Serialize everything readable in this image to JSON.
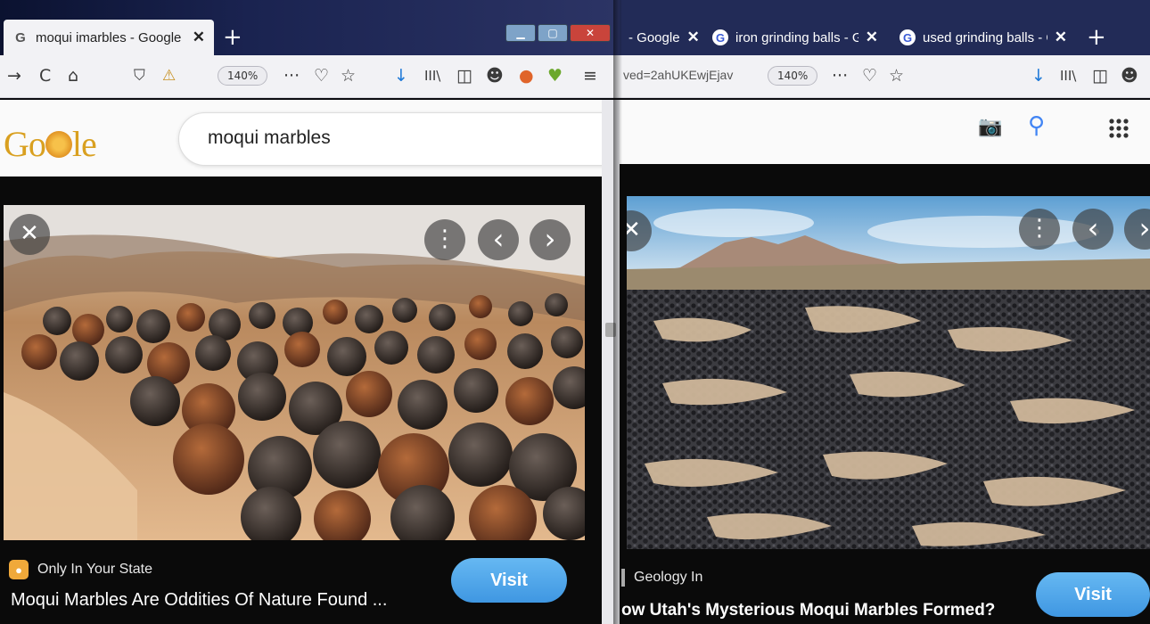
{
  "left_window": {
    "tab": {
      "favicon": "G",
      "title": "moqui imarbles - Google Searc",
      "close": "✕"
    },
    "new_tab": "+",
    "window_controls": {
      "minimize": "▁",
      "maximize": "▢",
      "close": "✕"
    },
    "toolbar": {
      "back": "→",
      "reload": "C",
      "home": "⌂",
      "shield": "⛉",
      "warning": "⚠",
      "zoom": "140%",
      "more": "···",
      "pocket": "♡",
      "bookmark": "☆",
      "download": "↓",
      "library": "III\\",
      "sidebar": "◫",
      "account": "☻",
      "ext1": "●",
      "ext2": "♥",
      "menu": "≡"
    },
    "google": {
      "logo_left": "Go",
      "logo_right": "le",
      "search_query": "moqui marbles"
    },
    "viewer": {
      "close_icon": "✕",
      "more_icon": "⋮",
      "prev_icon": "‹",
      "next_icon": "›",
      "source_name": "Only In Your State",
      "title": "Moqui Marbles Are Oddities Of Nature Found ...",
      "visit_label": "Visit"
    }
  },
  "right_window": {
    "tabs": [
      {
        "title": "- Google",
        "close": "✕"
      },
      {
        "favicon": "G",
        "title": "iron grinding balls - Goo",
        "close": "✕"
      },
      {
        "favicon": "G",
        "title": "used grinding balls - Goo",
        "close": "✕"
      }
    ],
    "new_tab": "+",
    "toolbar": {
      "url_fragment": "ved=2ahUKEwjEjav",
      "zoom": "140%",
      "more": "···",
      "pocket": "♡",
      "bookmark": "☆",
      "download": "↓",
      "library": "III\\",
      "sidebar": "◫",
      "account": "☻"
    },
    "google": {
      "camera_icon": "📷",
      "search_icon": "⚲"
    },
    "viewer": {
      "close_icon": "✕",
      "more_icon": "⋮",
      "prev_icon": "‹",
      "next_icon": "›",
      "source_name": "Geology In",
      "title": "ow Utah's Mysterious Moqui Marbles Formed?",
      "visit_label": "Visit"
    }
  }
}
